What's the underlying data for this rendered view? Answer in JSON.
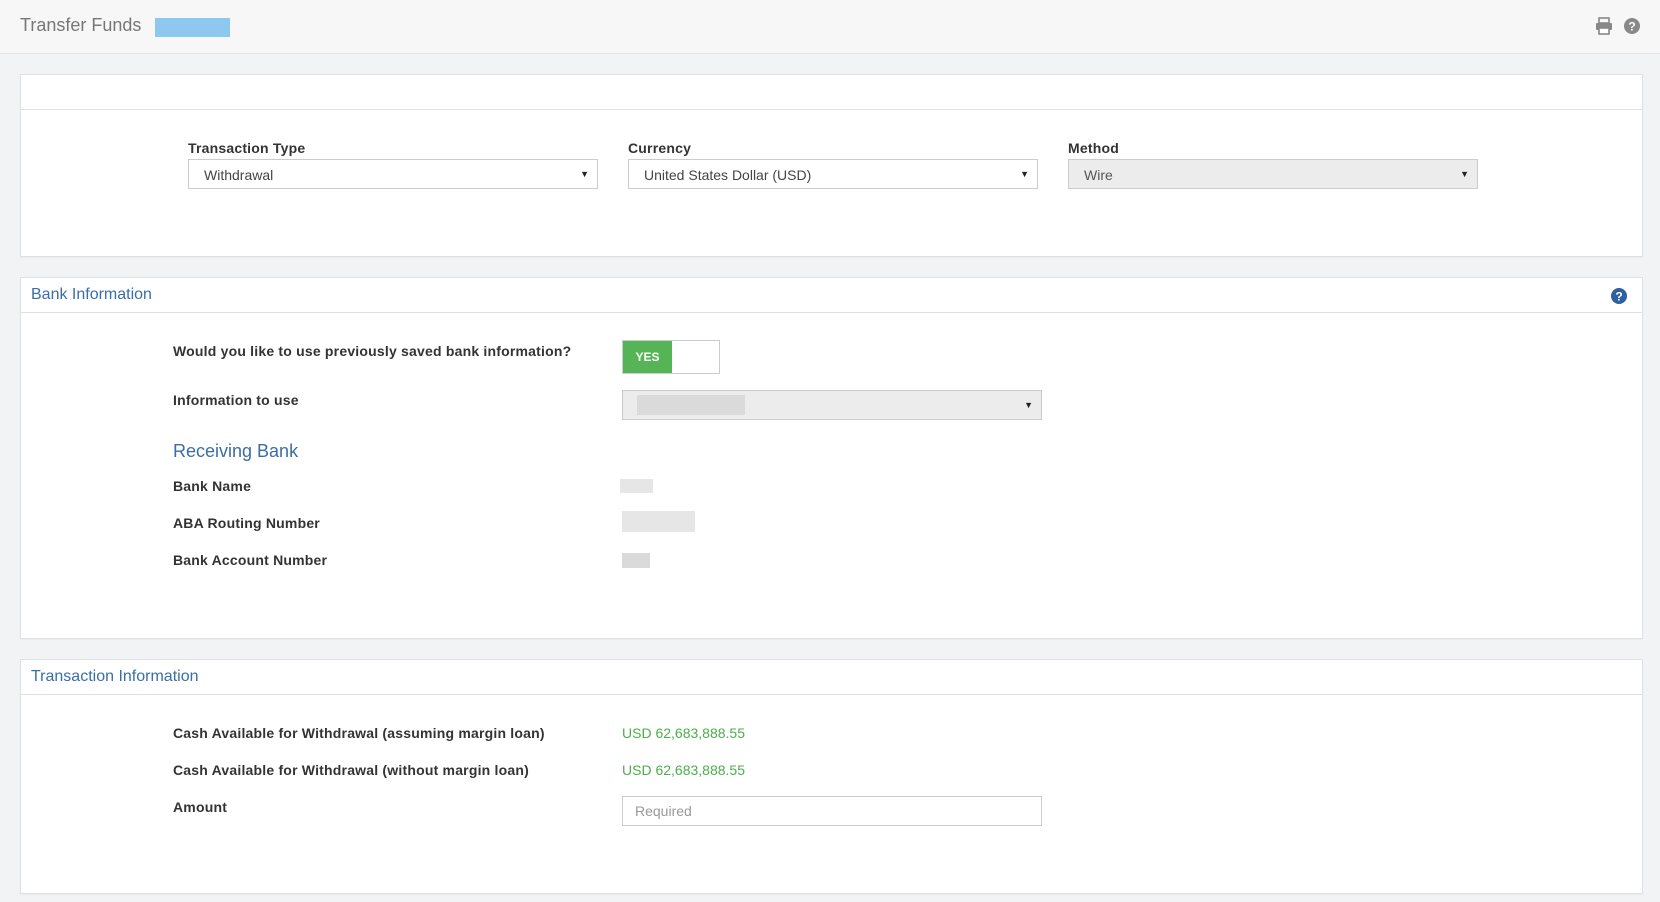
{
  "header": {
    "title": "Transfer Funds",
    "icons": [
      "print-icon",
      "help-icon"
    ]
  },
  "transfer": {
    "transaction_type_label": "Transaction Type",
    "transaction_type_value": "Withdrawal",
    "currency_label": "Currency",
    "currency_value": "United States Dollar (USD)",
    "method_label": "Method",
    "method_value": "Wire"
  },
  "bank_info": {
    "title": "Bank Information",
    "saved_question": "Would you like to use previously saved bank information?",
    "toggle_label": "YES",
    "info_to_use_label": "Information to use",
    "receiving_bank_heading": "Receiving Bank",
    "bank_name_label": "Bank Name",
    "aba_label": "ABA Routing Number",
    "account_label": "Bank Account Number"
  },
  "transaction_info": {
    "title": "Transaction Information",
    "cash_margin_label": "Cash Available for Withdrawal (assuming margin loan)",
    "cash_margin_value": "USD 62,683,888.55",
    "cash_no_margin_label": "Cash Available for Withdrawal (without margin loan)",
    "cash_no_margin_value": "USD 62,683,888.55",
    "amount_label": "Amount",
    "amount_placeholder": "Required"
  },
  "colors": {
    "accent": "#3a6ea5",
    "success": "#55b455",
    "money": "#4cae4c"
  }
}
